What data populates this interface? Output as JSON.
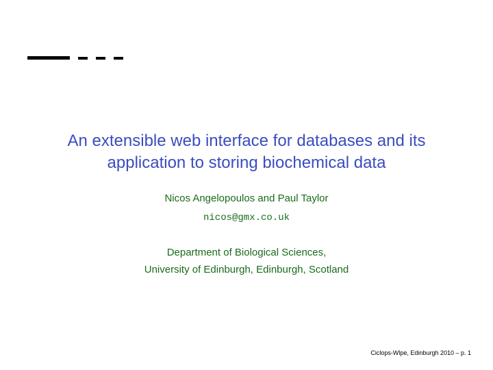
{
  "title": "An extensible web interface for databases and its application to storing biochemical data",
  "authors": "Nicos Angelopoulos and Paul Taylor",
  "email": "nicos@gmx.co.uk",
  "affiliation_line1": "Department of Biological Sciences,",
  "affiliation_line2": "University of Edinburgh, Edinburgh, Scotland",
  "footer": "Ciclops-Wlpe, Edinburgh 2010 – p. 1"
}
